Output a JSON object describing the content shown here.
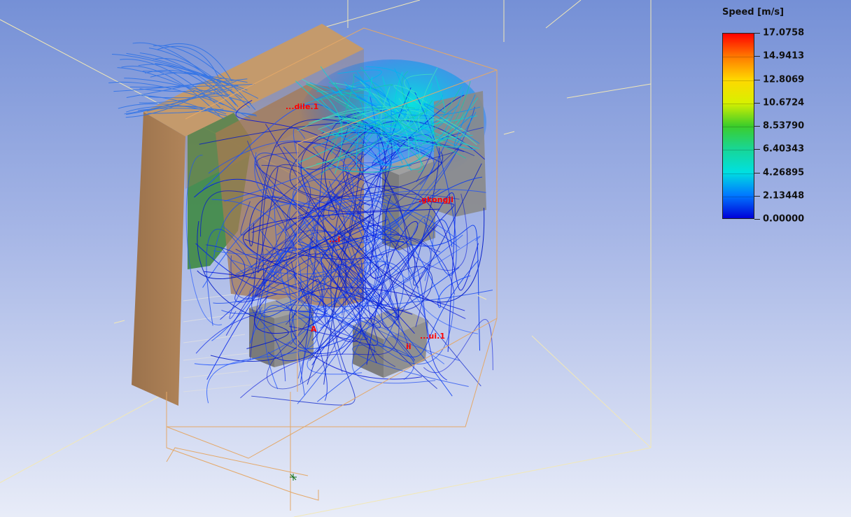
{
  "viewer": {
    "legend": {
      "title": "Speed [m/s]",
      "values": [
        "17.0758",
        "14.9413",
        "12.8069",
        "10.6724",
        "8.53790",
        "6.40343",
        "4.26895",
        "2.13448",
        "0.00000"
      ],
      "colors": [
        "#ff0000",
        "#ff7a00",
        "#ffd800",
        "#d8f000",
        "#3ccd2a",
        "#18d696",
        "#00e0e0",
        "#0078ff",
        "#0000d8"
      ]
    },
    "component_labels": [
      {
        "id": "label-top",
        "text": "...dile.1"
      },
      {
        "id": "label-kongji",
        "text": ".gkongji"
      },
      {
        "id": "label-mid",
        "text": "...i"
      },
      {
        "id": "label-lower-left",
        "text": "A"
      },
      {
        "id": "label-lower-right",
        "text": "...ui.1"
      },
      {
        "id": "label-lower-right-2",
        "text": "ii"
      }
    ],
    "colors": {
      "cabinet_panel": "#a57a52",
      "box": "#8b8b8b",
      "streamline_low": "#0018e0",
      "streamline_mid": "#00c8e8",
      "outline": "#e8b070",
      "domain": "#f0e6b4",
      "label": "#ff0000"
    }
  }
}
